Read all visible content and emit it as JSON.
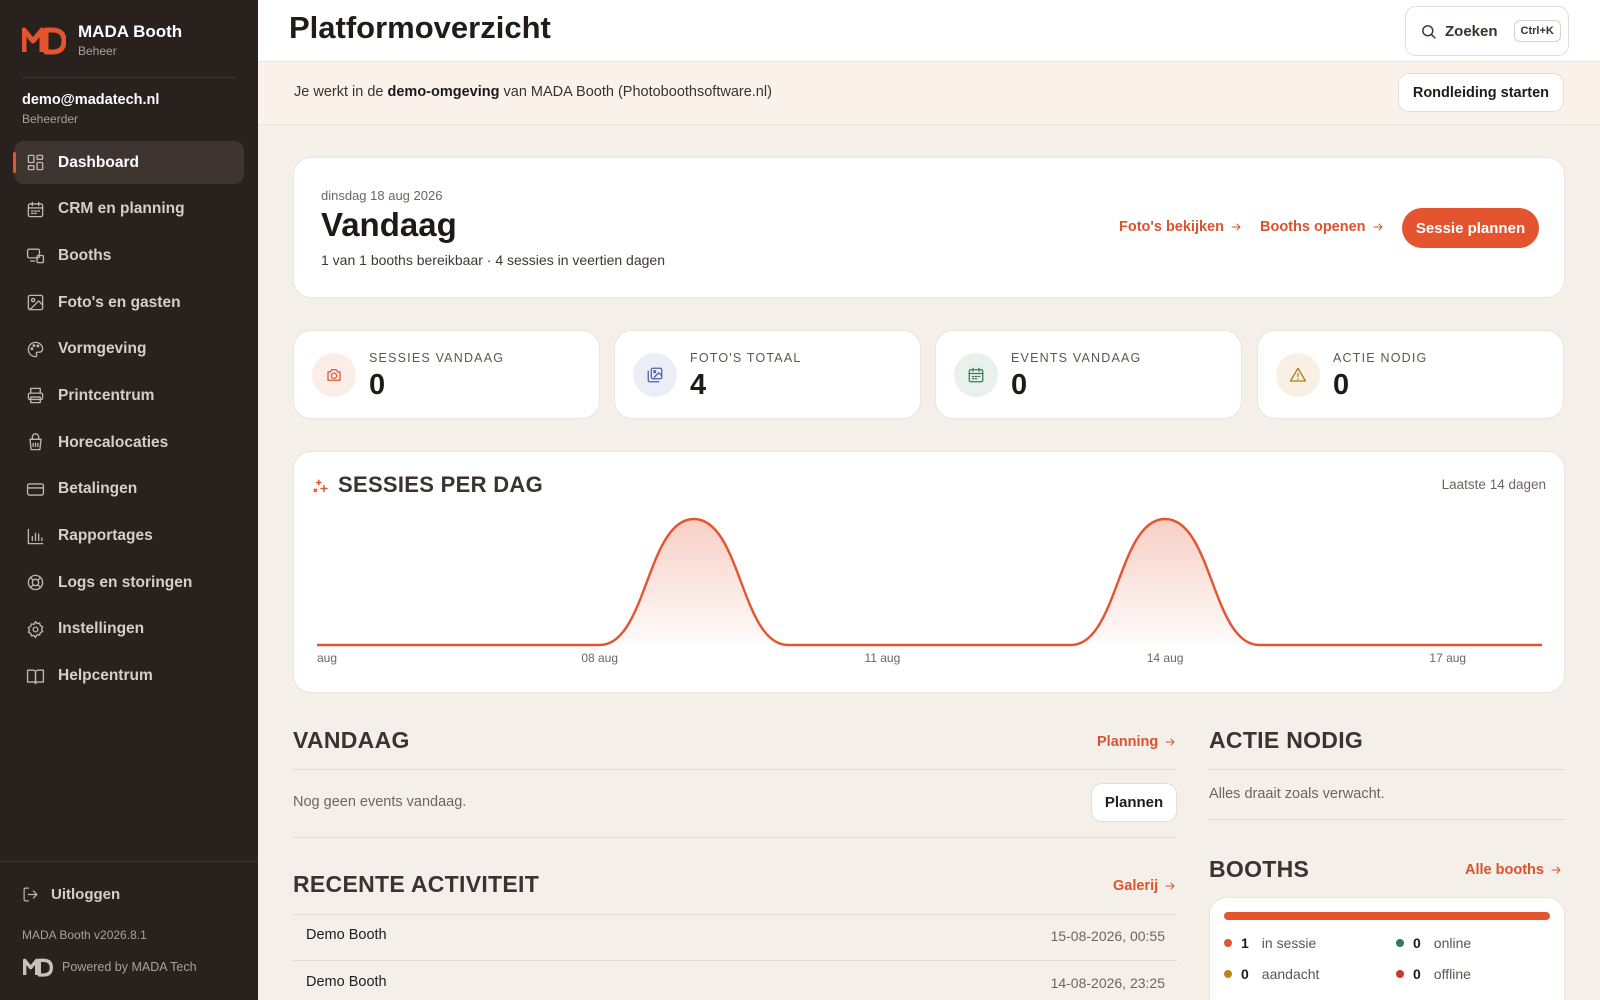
{
  "app": {
    "name": "MADA Booth",
    "subtitle": "Beheer"
  },
  "user": {
    "email": "demo@madatech.nl",
    "role": "Beheerder"
  },
  "nav": [
    {
      "label": "Dashboard",
      "icon": "grid-icon",
      "active": true
    },
    {
      "label": "CRM en planning",
      "icon": "calendar-icon"
    },
    {
      "label": "Booths",
      "icon": "booth-icon"
    },
    {
      "label": "Foto's en gasten",
      "icon": "image-icon"
    },
    {
      "label": "Vormgeving",
      "icon": "palette-icon"
    },
    {
      "label": "Printcentrum",
      "icon": "printer-icon"
    },
    {
      "label": "Horecalocaties",
      "icon": "cup-icon"
    },
    {
      "label": "Betalingen",
      "icon": "card-icon"
    },
    {
      "label": "Rapportages",
      "icon": "bar-chart-icon"
    },
    {
      "label": "Logs en storingen",
      "icon": "lifebuoy-icon"
    },
    {
      "label": "Instellingen",
      "icon": "gear-icon"
    },
    {
      "label": "Helpcentrum",
      "icon": "book-icon"
    }
  ],
  "logout_label": "Uitloggen",
  "version": "MADA Booth v2026.8.1",
  "powered_by": "Powered by MADA Tech",
  "header": {
    "title": "Platformoverzicht",
    "search_label": "Zoeken",
    "search_shortcut": "Ctrl+K"
  },
  "banner": {
    "prefix": "Je werkt in de",
    "highlight": "demo-omgeving",
    "suffix": "van MADA Booth (Photoboothsoftware.nl)",
    "tour_button": "Rondleiding starten"
  },
  "hero": {
    "date": "dinsdag 18 aug 2026",
    "title": "Vandaag",
    "subtitle": "1 van 1 booths bereikbaar · 4 sessies in veertien dagen",
    "link_photos": "Foto's bekijken",
    "link_booths": "Booths openen",
    "primary_button": "Sessie plannen"
  },
  "stats": [
    {
      "label": "SESSIES VANDAAG",
      "value": "0",
      "icon": "camera-icon",
      "color": "#e4542e",
      "bg": "#fbeee8"
    },
    {
      "label": "FOTO'S TOTAAL",
      "value": "4",
      "icon": "images-icon",
      "color": "#4a62a8",
      "bg": "#ebeef6"
    },
    {
      "label": "EVENTS VANDAAG",
      "value": "0",
      "icon": "calendar-icon",
      "color": "#3c7a5e",
      "bg": "#e8f1ec"
    },
    {
      "label": "ACTIE NODIG",
      "value": "0",
      "icon": "warning-icon",
      "color": "#b07a1e",
      "bg": "#f8f0e2"
    }
  ],
  "chart_data": {
    "type": "area",
    "title": "SESSIES PER DAG",
    "range_label": "Laatste 14 dagen",
    "x": [
      "05 aug",
      "06 aug",
      "07 aug",
      "08 aug",
      "09 aug",
      "10 aug",
      "11 aug",
      "12 aug",
      "13 aug",
      "14 aug",
      "15 aug",
      "16 aug",
      "17 aug",
      "18 aug"
    ],
    "tick_labels": [
      "aug",
      "08 aug",
      "11 aug",
      "14 aug",
      "17 aug"
    ],
    "values": [
      0,
      0,
      0,
      0,
      2,
      0,
      0,
      0,
      0,
      2,
      0,
      0,
      0,
      0
    ],
    "color": "#e4542e",
    "grid": false
  },
  "today": {
    "title": "VANDAAG",
    "link": "Planning",
    "empty_text": "Nog geen events vandaag.",
    "button": "Plannen"
  },
  "activity": {
    "title": "RECENTE ACTIVITEIT",
    "link": "Galerij",
    "rows": [
      {
        "name": "Demo Booth",
        "time": "15-08-2026, 00:55"
      },
      {
        "name": "Demo Booth",
        "time": "14-08-2026, 23:25"
      }
    ]
  },
  "action": {
    "title": "ACTIE NODIG",
    "text": "Alles draait zoals verwacht."
  },
  "booths": {
    "title": "BOOTHS",
    "link": "Alle booths",
    "status": [
      {
        "count": "1",
        "label": "in sessie",
        "color": "#e4542e"
      },
      {
        "count": "0",
        "label": "online",
        "color": "#2f7a5a"
      },
      {
        "count": "0",
        "label": "aandacht",
        "color": "#b8861c"
      },
      {
        "count": "0",
        "label": "offline",
        "color": "#c8382b"
      }
    ]
  }
}
